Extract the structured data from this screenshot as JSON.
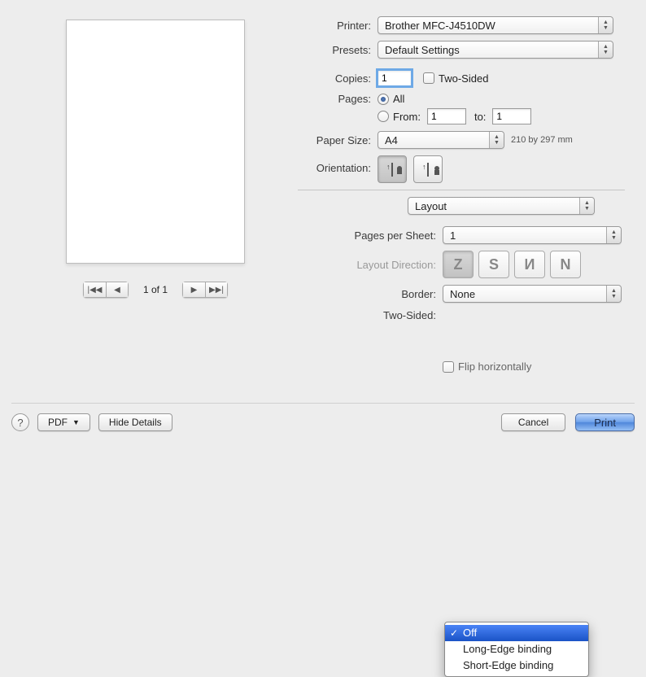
{
  "labels": {
    "printer": "Printer:",
    "presets": "Presets:",
    "copies": "Copies:",
    "two_sided_check": "Two-Sided",
    "pages": "Pages:",
    "all": "All",
    "from": "From:",
    "to": "to:",
    "paper_size": "Paper Size:",
    "orientation": "Orientation:",
    "section_select": "Layout",
    "pages_per_sheet": "Pages per Sheet:",
    "layout_direction": "Layout Direction:",
    "border": "Border:",
    "two_sided": "Two-Sided:",
    "flip_horizontally": "Flip horizontally"
  },
  "values": {
    "printer": "Brother MFC-J4510DW",
    "presets": "Default Settings",
    "copies": "1",
    "from": "1",
    "to": "1",
    "paper_size": "A4",
    "paper_size_hint": "210 by 297 mm",
    "pages_per_sheet": "1",
    "border": "None",
    "two_sided_selected": "Off"
  },
  "pager": {
    "first_icon": "|◀◀",
    "prev_icon": "◀",
    "indicator": "1 of 1",
    "next_icon": "▶",
    "last_icon": "▶▶|"
  },
  "two_sided_options": [
    "Off",
    "Long-Edge binding",
    "Short-Edge binding"
  ],
  "footer": {
    "help": "?",
    "pdf": "PDF",
    "pdf_caret": "▼",
    "hide_details": "Hide Details",
    "cancel": "Cancel",
    "print": "Print"
  }
}
